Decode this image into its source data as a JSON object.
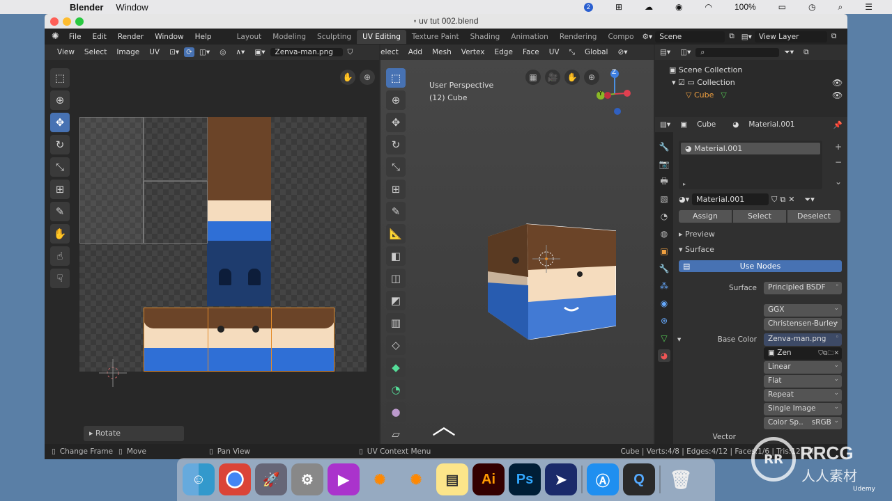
{
  "mac_menubar": {
    "apple": "",
    "app": "Blender",
    "window": "Window",
    "battery": "100%",
    "badge": "2"
  },
  "window_title": "uv tut 002.blend",
  "top_menu": [
    "File",
    "Edit",
    "Render",
    "Window",
    "Help"
  ],
  "workspace_tabs": [
    "Layout",
    "Modeling",
    "Sculpting",
    "UV Editing",
    "Texture Paint",
    "Shading",
    "Animation",
    "Rendering",
    "Compo"
  ],
  "active_tab": "UV Editing",
  "scene": "Scene",
  "view_layer": "View Layer",
  "uv_editor": {
    "menus": [
      "View",
      "Select",
      "Image",
      "UV"
    ],
    "image_name": "Zenva-man.png",
    "rotate_panel": "Rotate"
  },
  "viewport": {
    "menus": [
      "elect",
      "Add",
      "Mesh",
      "Vertex",
      "Edge",
      "Face",
      "UV"
    ],
    "orientation": "Global",
    "perspective": "User Perspective",
    "object_info": "(12) Cube",
    "axis_z": "Z",
    "axis_y": "Y"
  },
  "outliner": {
    "scene_collection": "Scene Collection",
    "collection": "Collection",
    "object": "Cube"
  },
  "properties": {
    "object": "Cube",
    "material_tab": "Material.001",
    "slot": "Material.001",
    "material_name": "Material.001",
    "assign": "Assign",
    "select": "Select",
    "deselect": "Deselect",
    "preview": "Preview",
    "surface_panel": "Surface",
    "use_nodes": "Use Nodes",
    "surface_label": "Surface",
    "surface_value": "Principled BSDF",
    "distribution": "GGX",
    "subsurface": "Christensen-Burley",
    "base_color_label": "Base Color",
    "base_color_value": "Zenva-man.png",
    "image_short": "Zen",
    "interpolation": "Linear",
    "projection": "Flat",
    "extension": "Repeat",
    "source": "Single Image",
    "color_space_label": "Color Sp..",
    "color_space_value": "sRGB",
    "vector_label": "Vector"
  },
  "statusbar": {
    "change_frame": "Change Frame",
    "move": "Move",
    "pan_view": "Pan View",
    "uv_context": "UV Context Menu",
    "stats": "Cube | Verts:4/8 | Edges:4/12 | Faces:1/6 | Tris:12 | M"
  },
  "watermark": {
    "brand": "RRCG",
    "sub": "人人素材",
    "udemy": "Udemy"
  },
  "dock_apps": [
    "Finder",
    "Chrome",
    "Launchpad",
    "System Preferences",
    "Screenflow",
    "Blender",
    "Blender",
    "Notes",
    "Ai",
    "Ps",
    "Cursor",
    "App Store",
    "QuickTime",
    "Trash"
  ],
  "colors": {
    "accent": "#4772b3",
    "skin": "#f5dcbe",
    "hair": "#6b4428",
    "shirt": "#2f6fd6",
    "selected_outline": "#e38b2a"
  }
}
